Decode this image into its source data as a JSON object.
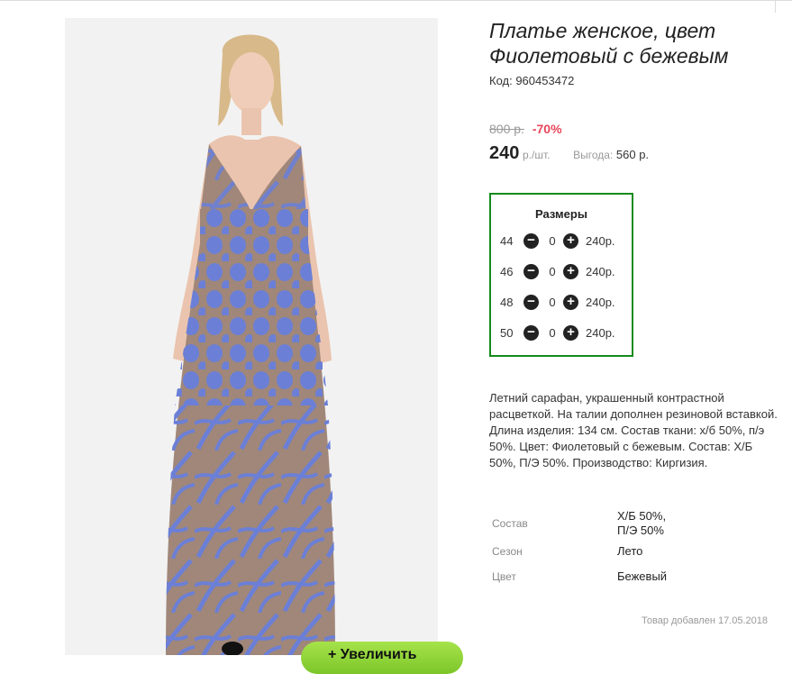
{
  "product": {
    "title": "Платье женское, цвет Фиолетовый с бежевым",
    "code_label": "Код: 960453472"
  },
  "pricing": {
    "old_price": "800 р.",
    "discount": "-70%",
    "price": "240",
    "unit": "р./шт.",
    "benefit_label": "Выгода:",
    "benefit_value": "560 р."
  },
  "sizes": {
    "title": "Размеры",
    "rows": [
      {
        "size": "44",
        "qty": "0",
        "price": "240р."
      },
      {
        "size": "46",
        "qty": "0",
        "price": "240р."
      },
      {
        "size": "48",
        "qty": "0",
        "price": "240р."
      },
      {
        "size": "50",
        "qty": "0",
        "price": "240р."
      }
    ],
    "minus_symbol": "−",
    "plus_symbol": "+"
  },
  "description": "Летний сарафан, украшенный контрастной расцветкой. На талии дополнен резиновой вставкой. Длина изделия: 134 см. Состав ткани: х/б 50%, п/э 50%. Цвет: Фиолетовый с бежевым. Состав: Х/Б 50%, П/Э 50%. Производство: Киргизия.",
  "properties": [
    {
      "label": "Состав",
      "value_line1": "Х/Б 50%,",
      "value_line2": "П/Э 50%"
    },
    {
      "label": "Сезон",
      "value_line1": "Лето",
      "value_line2": ""
    },
    {
      "label": "Цвет",
      "value_line1": "Бежевый",
      "value_line2": ""
    }
  ],
  "added_date": "Товар добавлен 17.05.2018",
  "zoom_button": "+ Увеличить",
  "colors": {
    "accent_green": "#138a1c",
    "discount_red": "#e8465a",
    "button_green": "#8fd43a",
    "dress_beige": "#a0877a",
    "dress_pattern": "#6b7fd6"
  },
  "icons": [
    "minus-circle-icon",
    "plus-circle-icon"
  ]
}
